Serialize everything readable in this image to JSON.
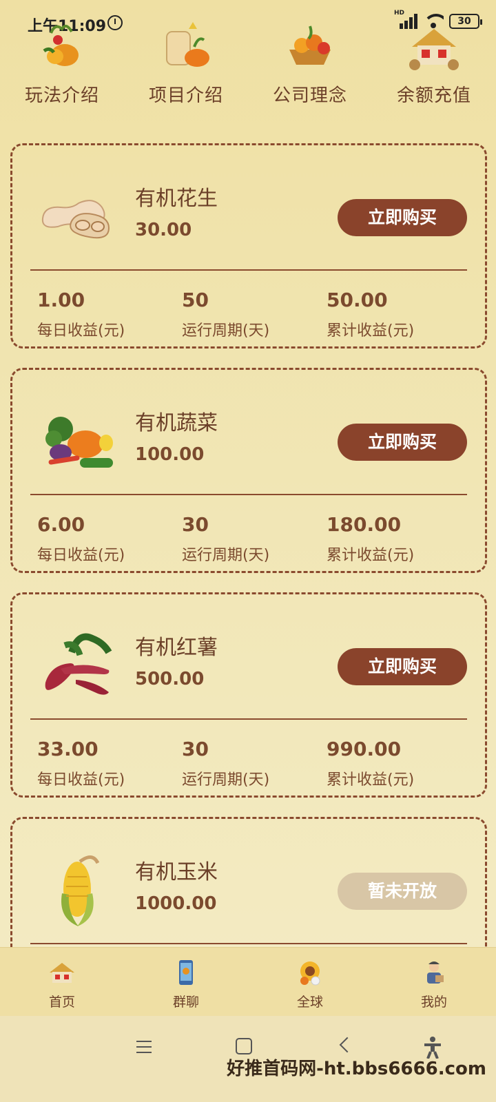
{
  "status_bar": {
    "time": "上午11:09",
    "battery": "30",
    "network_label": "HD"
  },
  "top_nav": [
    {
      "label": "玩法介绍",
      "icon": "harvest-basket-icon"
    },
    {
      "label": "项目介绍",
      "icon": "grain-sack-pumpkin-icon"
    },
    {
      "label": "公司理念",
      "icon": "fruit-basket-icon"
    },
    {
      "label": "余额充值",
      "icon": "farm-house-icon"
    }
  ],
  "stat_labels": {
    "daily": "每日收益(元)",
    "period": "运行周期(天)",
    "total": "累计收益(元)"
  },
  "products": [
    {
      "name": "有机花生",
      "price": "30.00",
      "button": "立即购买",
      "daily": "1.00",
      "period": "50",
      "total": "50.00",
      "icon": "peanut-icon",
      "available": true
    },
    {
      "name": "有机蔬菜",
      "price": "100.00",
      "button": "立即购买",
      "daily": "6.00",
      "period": "30",
      "total": "180.00",
      "icon": "vegetables-icon",
      "available": true
    },
    {
      "name": "有机红薯",
      "price": "500.00",
      "button": "立即购买",
      "daily": "33.00",
      "period": "30",
      "total": "990.00",
      "icon": "sweet-potato-icon",
      "available": true
    },
    {
      "name": "有机玉米",
      "price": "1000.00",
      "button": "暂未开放",
      "icon": "corn-icon",
      "available": false
    }
  ],
  "tab_bar": [
    {
      "label": "首页",
      "icon": "home-house-icon"
    },
    {
      "label": "群聊",
      "icon": "group-chat-icon"
    },
    {
      "label": "全球",
      "icon": "global-sunflower-icon"
    },
    {
      "label": "我的",
      "icon": "profile-farmer-icon"
    }
  ],
  "watermark": "好推首码网-ht.bbs6666.com",
  "colors": {
    "accent": "#8a432b",
    "disabled_button": "#d8c6a6",
    "text": "#7b4a2e",
    "background": "#efe0a3"
  }
}
